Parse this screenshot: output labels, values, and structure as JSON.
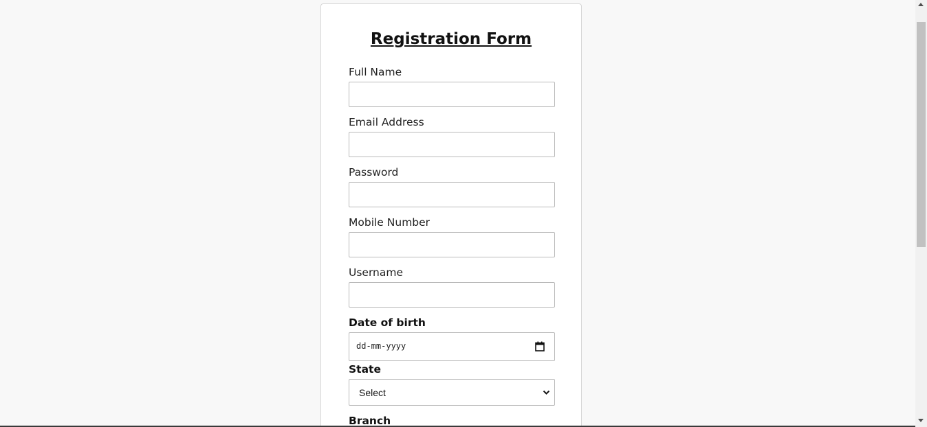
{
  "form": {
    "title": "Registration Form",
    "fields": {
      "full_name": {
        "label": "Full Name",
        "value": ""
      },
      "email": {
        "label": "Email Address",
        "value": ""
      },
      "password": {
        "label": "Password",
        "value": ""
      },
      "mobile": {
        "label": "Mobile Number",
        "value": ""
      },
      "username": {
        "label": "Username",
        "value": ""
      },
      "dob": {
        "label": "Date of birth",
        "placeholder": "dd-mm-yyyy",
        "icon": "calendar-icon"
      },
      "state": {
        "label": "State",
        "selected": "Select",
        "icon": "chevron-down-icon"
      },
      "branch": {
        "label": "Branch"
      }
    }
  },
  "colors": {
    "page_background": "#f8f8f8",
    "card_background": "#ffffff",
    "border": "#b9b9b9",
    "scroll_thumb": "#c1c1c1"
  }
}
